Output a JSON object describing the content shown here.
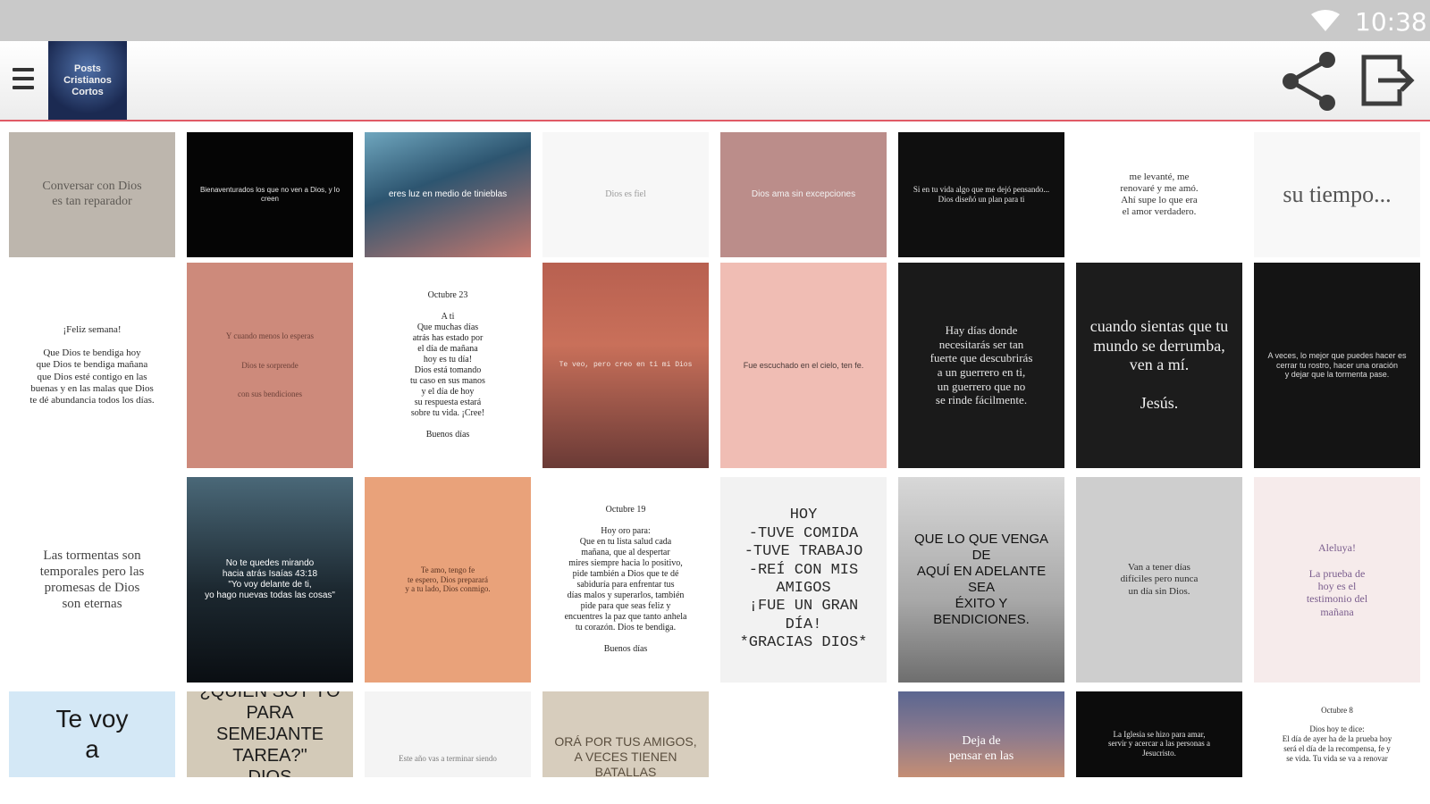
{
  "status_bar": {
    "time": "10:38",
    "wifi_icon": "wifi-icon"
  },
  "toolbar": {
    "menu_icon": "hamburger-menu-icon",
    "logo_text": "Posts\nCristianos\nCortos",
    "share_icon": "share-icon",
    "exit_icon": "exit-icon"
  },
  "grid": {
    "tiles": [
      {
        "bg": "#bdb6ad",
        "fg": "#5e5a55",
        "font": "serif",
        "size": 14,
        "text": "Conversar con Dios\nes tan reparador"
      },
      {
        "bg": "#050505",
        "fg": "#e6e6e6",
        "font": "sans",
        "size": 8,
        "text": "Bienaventurados los que no ven a Dios, y lo creen"
      },
      {
        "bg": "linear-gradient(160deg,#6fa6be 0%,#2d5570 40%,#c5786e 100%)",
        "fg": "#ffffff",
        "font": "sans",
        "size": 10,
        "text": "eres luz en medio de tinieblas"
      },
      {
        "bg": "#f7f7f7",
        "fg": "#9a9a9a",
        "font": "serif",
        "size": 10,
        "text": "Dios es fiel"
      },
      {
        "bg": "#bb8d8a",
        "fg": "#f2f2f2",
        "font": "sans",
        "size": 10,
        "text": "Dios ama sin excepciones"
      },
      {
        "bg": "#0f0f0f",
        "fg": "#e8e8e8",
        "font": "serif",
        "size": 9,
        "text": "Si en tu vida algo que me dejó pensando... Dios diseñó un plan para ti"
      },
      {
        "bg": "#ffffff",
        "fg": "#333333",
        "font": "serif",
        "size": 11,
        "text": "me levanté, me\nrenovaré y me amó.\nAhí supe lo que era\nel amor verdadero."
      },
      {
        "bg": "#f8f8f8",
        "fg": "#555555",
        "font": "serif",
        "size": 26,
        "text": "su tiempo..."
      },
      {
        "bg": "#ffffff",
        "fg": "#2a2a2a",
        "font": "serif",
        "size": 11,
        "text": "¡Feliz semana!\n\nQue Dios te bendiga hoy\nque Dios te bendiga mañana\nque Dios esté contigo en las\nbuenas y en las malas que Dios\nte dé abundancia todos los días."
      },
      {
        "bg": "#cd8a7b",
        "fg": "#6b4038",
        "font": "serif",
        "size": 9,
        "text": "Y cuando menos lo esperas\n\n\nDios te sorprende\n\n\ncon sus bendiciones"
      },
      {
        "bg": "#ffffff",
        "fg": "#222222",
        "font": "serif",
        "size": 10,
        "text": "Octubre 23\n\nA ti\nQue muchas días\natrás has estado por\nel día de mañana\nhoy es tu día!\nDios está tomando\ntu caso en sus manos\ny el día de hoy\nsu respuesta estará\nsobre tu vida. ¡Cree!\n\nBuenos días"
      },
      {
        "bg": "linear-gradient(180deg,#b86050 0%,#c9705a 40%,#6a3a36 100%)",
        "fg": "#f4e6e0",
        "font": "mono",
        "size": 8,
        "text": "Te veo, pero creo en ti mi Dios"
      },
      {
        "bg": "#f0bdb4",
        "fg": "#4a3a38",
        "font": "sans",
        "size": 9,
        "text": "Fue escuchado en el cielo, ten fe."
      },
      {
        "bg": "#1a1a1a",
        "fg": "#e4e4e4",
        "font": "serif",
        "size": 13,
        "text": "Hay días donde\nnecesitarás ser tan\nfuerte que descubrirás\na un guerrero en ti,\nun guerrero que no\nse rinde fácilmente."
      },
      {
        "bg": "#1c1c1c",
        "fg": "#f0f0f0",
        "font": "serif",
        "size": 18,
        "text": "cuando sientas que tu\nmundo se derrumba,\nven a mí.\n\nJesús."
      },
      {
        "bg": "#141414",
        "fg": "#dcdcdc",
        "font": "sans",
        "size": 9,
        "text": "A veces, lo mejor que puedes hacer es\ncerrar tu rostro, hacer una oración\ny dejar que la tormenta pase."
      },
      {
        "bg": "#ffffff",
        "fg": "#444444",
        "font": "serif",
        "size": 15,
        "text": "Las tormentas son\ntemporales pero las\npromesas de Dios\nson eternas"
      },
      {
        "bg": "linear-gradient(180deg,#4a6878 0%,#1c2830 55%,#0a0e12 100%)",
        "fg": "#ffffff",
        "font": "sans",
        "size": 10,
        "text": "No te quedes mirando\nhacia atrás Isaías 43:18\n\"Yo voy delante de ti,\nyo hago nuevas todas las cosas\""
      },
      {
        "bg": "#e9a27a",
        "fg": "#5a3322",
        "font": "serif",
        "size": 9,
        "text": "Te amo, tengo fe\nte espero, Dios preparará\ny a tu lado, Dios conmigo."
      },
      {
        "bg": "#ffffff",
        "fg": "#222222",
        "font": "serif",
        "size": 10,
        "text": "Octubre 19\n\nHoy oro para:\nQue en tu lista salud cada\nmañana, que al despertar\nmires siempre hacia lo positivo,\npide también a Dios que te dé\nsabiduría para enfrentar tus\ndías malos y superarlos, también\npide para que seas feliz y\nencuentres la paz que tanto anhela\ntu corazón. Dios te bendiga.\n\nBuenos días"
      },
      {
        "bg": "#f2f2f2",
        "fg": "#2a2a2a",
        "font": "mono",
        "size": 17,
        "text": "HOY\n-TUVE COMIDA\n-TUVE TRABAJO\n-REÍ CON MIS AMIGOS\n¡FUE UN GRAN DÍA!\n*GRACIAS DIOS*"
      },
      {
        "bg": "linear-gradient(180deg,#d8d8d8 0%,#a8a8a8 60%,#6e6e6e 100%)",
        "fg": "#111111",
        "font": "sans",
        "size": 15,
        "text": "QUE LO QUE VENGA DE\nAQUÍ EN ADELANTE SEA\nÉXITO Y BENDICIONES."
      },
      {
        "bg": "#cecece",
        "fg": "#2e2e2e",
        "font": "serif",
        "size": 11,
        "text": "Van a tener días\ndifíciles pero nunca\nun día sin Dios."
      },
      {
        "bg": "#f6ebeb",
        "fg": "#7b5e8e",
        "font": "serif",
        "size": 12,
        "text": "Aleluya!\n\nLa prueba de\nhoy es el\ntestimonio del\nmañana"
      },
      {
        "bg": "#d4e8f6",
        "fg": "#1a1a1a",
        "font": "sans",
        "size": 28,
        "text": "Te voy\na"
      },
      {
        "bg": "#d3cab8",
        "fg": "#1c1c1c",
        "font": "sans",
        "size": 20,
        "text": "MOISÉS DIJO:\n¿QUIÉN SOY YO PARA\nSEMEJANTE TAREA?\"\nDIOS RESPONDIÓ"
      },
      {
        "bg": "#f4f4f4",
        "fg": "#7a7a7a",
        "font": "serif",
        "size": 9,
        "text": "\n\n\n\n\nEste año vas a terminar siendo"
      },
      {
        "bg": "#d7cdbd",
        "fg": "#5a4e3e",
        "font": "sans",
        "size": 14,
        "text": "\n\n\nORÁ POR TUS AMIGOS,\nA VECES TIENEN BATALLAS"
      },
      {
        "bg": "#ffffff",
        "fg": "#999999",
        "font": "sans",
        "size": 9,
        "text": " "
      },
      {
        "bg": "linear-gradient(180deg,#5a6690 0%,#8b7a8e 50%,#c58e74 100%)",
        "fg": "#ffffff",
        "font": "serif",
        "size": 14,
        "text": "\n\nDeja de\npensar en las"
      },
      {
        "bg": "#0c0c0c",
        "fg": "#e6e6e6",
        "font": "serif",
        "size": 9,
        "text": "\n\nLa Iglesia se hizo para amar,\nservir y acercar a las personas a\nJesucristo."
      },
      {
        "bg": "#ffffff",
        "fg": "#2a2a2a",
        "font": "serif",
        "size": 9,
        "text": "Octubre 8\n\nDios hoy te dice:\nEl día de ayer ha de la prueba hoy\nserá el día de la recompensa, fe y\nse vida. Tu vida se va a renovar"
      }
    ]
  }
}
